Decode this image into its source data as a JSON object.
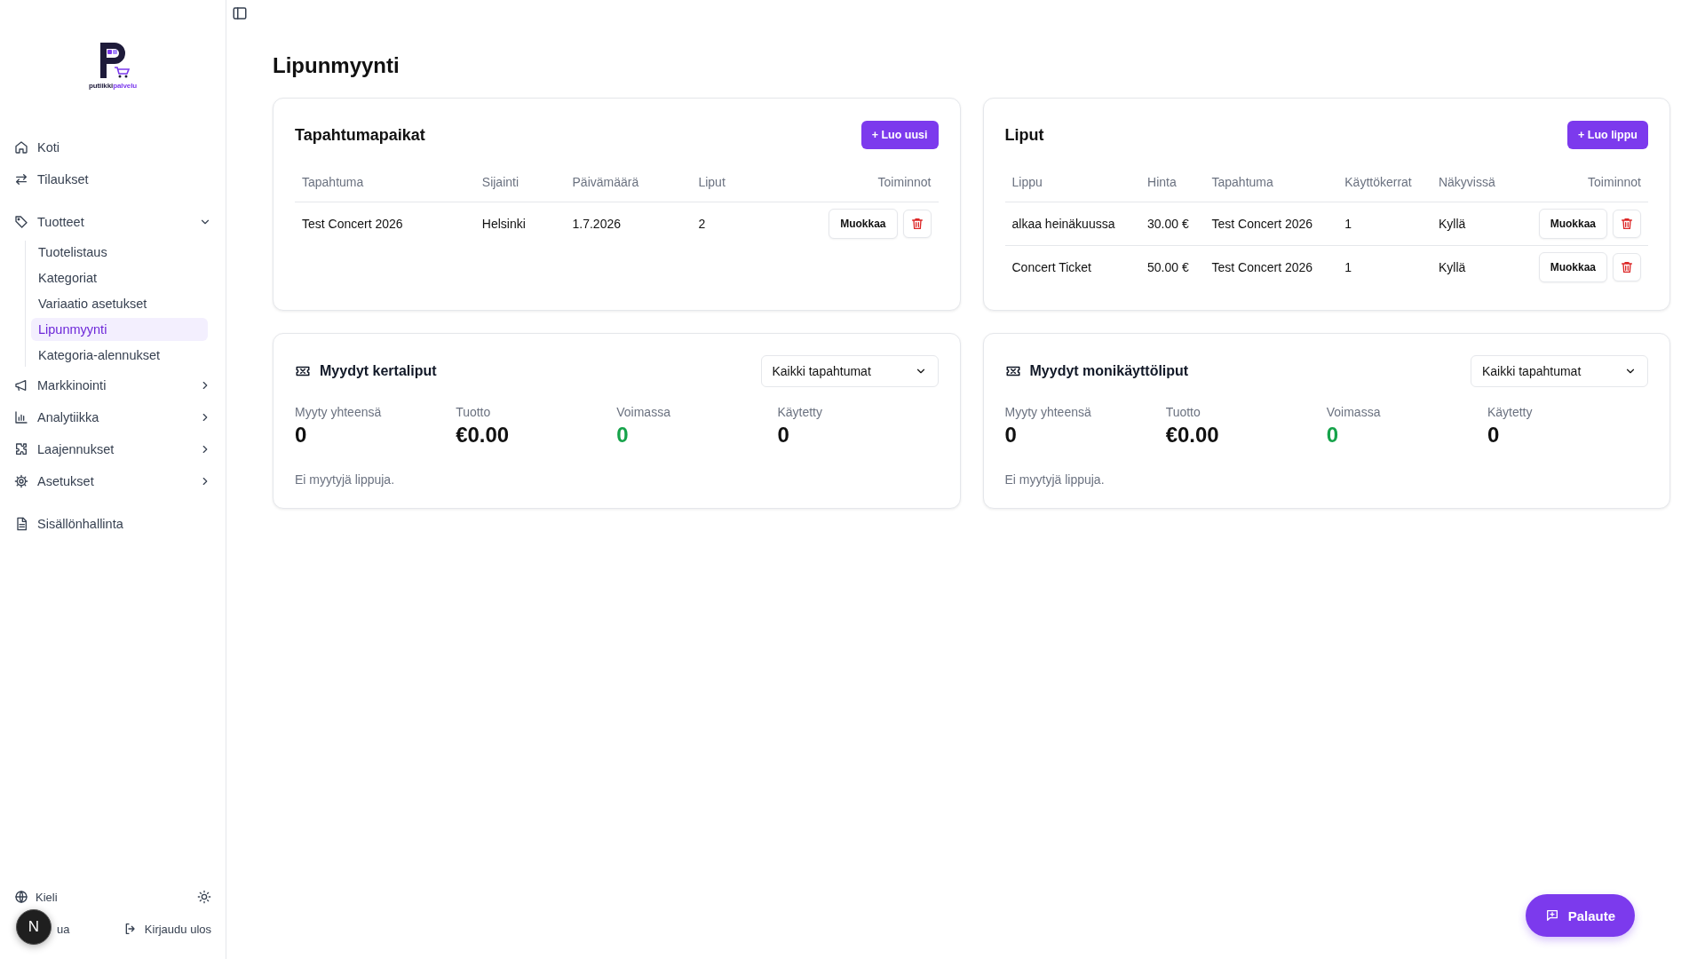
{
  "sidebar": {
    "logo": {
      "text_dark": "putiikki",
      "text_accent": "palvelu"
    },
    "nav_sections": [
      {
        "items": [
          {
            "label": "Koti",
            "kind": "link",
            "selected": false
          },
          {
            "label": "Tilaukset",
            "kind": "link",
            "selected": false
          }
        ]
      },
      {
        "items": [
          {
            "label": "Tuotteet",
            "kind": "group",
            "expanded": true,
            "children": [
              {
                "label": "Tuotelistaus",
                "selected": false
              },
              {
                "label": "Kategoriat",
                "selected": false
              },
              {
                "label": "Variaatio asetukset",
                "selected": false
              },
              {
                "label": "Lipunmyynti",
                "selected": true
              },
              {
                "label": "Kategoria-alennukset",
                "selected": false
              }
            ]
          },
          {
            "label": "Markkinointi",
            "kind": "group",
            "expanded": false
          },
          {
            "label": "Analytiikka",
            "kind": "group",
            "expanded": false
          },
          {
            "label": "Laajennukset",
            "kind": "group",
            "expanded": false
          },
          {
            "label": "Asetukset",
            "kind": "group",
            "expanded": false
          }
        ]
      },
      {
        "items": [
          {
            "label": "Sisällönhallinta",
            "kind": "link",
            "selected": false
          }
        ]
      }
    ],
    "footer": {
      "language": "Kieli",
      "partial_link": "ua",
      "logout": "Kirjaudu ulos"
    }
  },
  "dev_badge": {
    "label": "N"
  },
  "page": {
    "title": "Lipunmyynti"
  },
  "cards": [
    {
      "kind": "table",
      "title": "Tapahtumapaikat",
      "action": "+ Luo uusi",
      "columns": [
        "Tapahtuma",
        "Sijainti",
        "Päivämäärä",
        "Liput",
        "Toiminnot"
      ],
      "rows": [
        {
          "cells": [
            "Test Concert 2026",
            "Helsinki",
            "1.7.2026",
            "2"
          ],
          "edit": "Muokkaa"
        }
      ]
    },
    {
      "kind": "table",
      "title": "Liput",
      "action": "+ Luo lippu",
      "columns": [
        "Lippu",
        "Hinta",
        "Tapahtuma",
        "Käyttökerrat",
        "Näkyvissä",
        "Toiminnot"
      ],
      "rows": [
        {
          "cells": [
            "alkaa heinäkuussa",
            "30.00 €",
            "Test Concert 2026",
            "1",
            "Kyllä"
          ],
          "edit": "Muokkaa"
        },
        {
          "cells": [
            "Concert Ticket",
            "50.00 €",
            "Test Concert 2026",
            "1",
            "Kyllä"
          ],
          "edit": "Muokkaa"
        }
      ]
    },
    {
      "kind": "stats",
      "title": "Myydyt kertaliput",
      "filter": "Kaikki tapahtumat",
      "stats": [
        {
          "label": "Myyty yhteensä",
          "value": "0",
          "kind": "plain"
        },
        {
          "label": "Tuotto",
          "value": "€0.00",
          "kind": "plain"
        },
        {
          "label": "Voimassa",
          "value": "0",
          "kind": "positive"
        },
        {
          "label": "Käytetty",
          "value": "0",
          "kind": "plain"
        }
      ],
      "empty": "Ei myytyjä lippuja."
    },
    {
      "kind": "stats",
      "title": "Myydyt monikäyttöliput",
      "filter": "Kaikki tapahtumat",
      "stats": [
        {
          "label": "Myyty yhteensä",
          "value": "0",
          "kind": "plain"
        },
        {
          "label": "Tuotto",
          "value": "€0.00",
          "kind": "plain"
        },
        {
          "label": "Voimassa",
          "value": "0",
          "kind": "positive"
        },
        {
          "label": "Käytetty",
          "value": "0",
          "kind": "plain"
        }
      ],
      "empty": "Ei myytyjä lippuja."
    }
  ],
  "feedback_button": {
    "label": "Palaute"
  }
}
